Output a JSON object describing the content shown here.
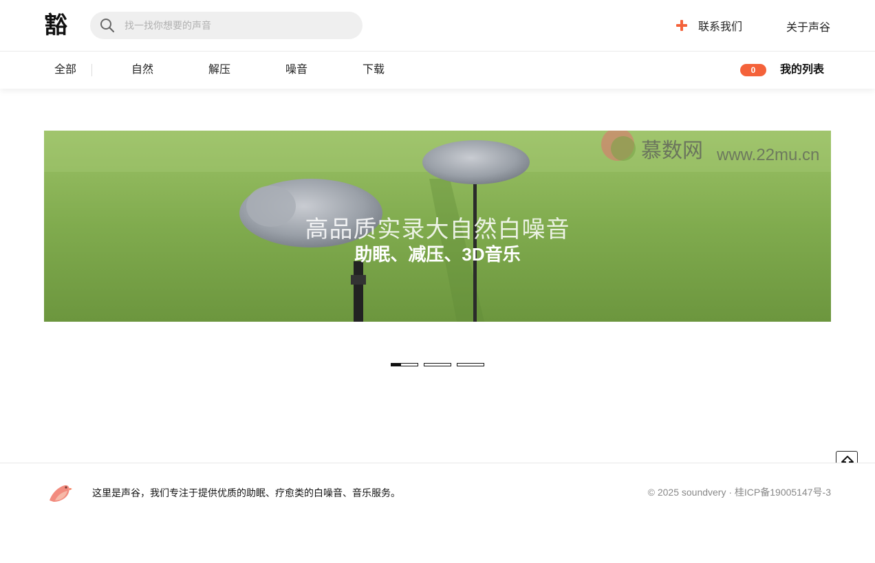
{
  "header": {
    "logo_text": "豁",
    "search_placeholder": "找一找你想要的声音",
    "contact_label": "联系我们",
    "about_label": "关于声谷"
  },
  "nav": {
    "items": [
      {
        "label": "全部"
      },
      {
        "label": "自然"
      },
      {
        "label": "解压"
      },
      {
        "label": "噪音"
      },
      {
        "label": "下载"
      }
    ],
    "list_count": "0",
    "my_list_label": "我的列表"
  },
  "banner": {
    "title": "高品质实录大自然白噪音",
    "subtitle": "助眠、减压、3D音乐",
    "watermark_brand": "慕数网",
    "watermark_url": "www.22mu.cn",
    "slide_count": 3,
    "active_slide": 1
  },
  "footer": {
    "description": "这里是声谷，我们专注于提供优质的助眠、疗愈类的白噪音、音乐服务。",
    "copyright": "© 2025 soundvery · 桂ICP备19005147号-3"
  },
  "colors": {
    "accent": "#f4623a",
    "banner_green": "#7eaa4d"
  },
  "icons": {
    "search": "search-icon",
    "contact": "plus-icon",
    "back_to_top": "arrow-up-icon",
    "footer_logo": "bird-icon"
  }
}
